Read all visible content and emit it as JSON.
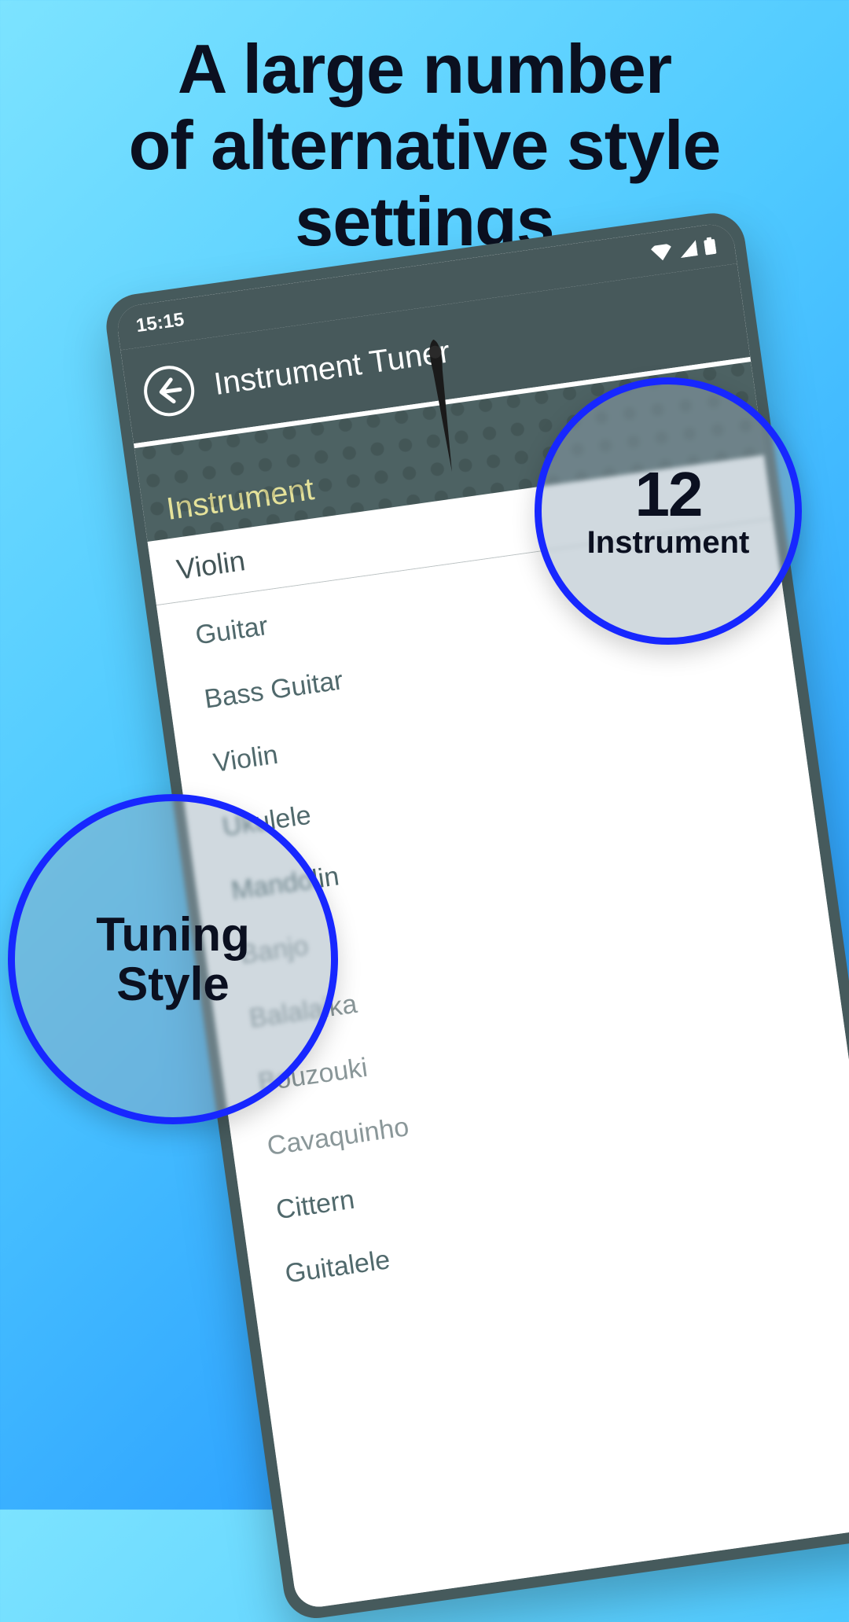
{
  "headline": {
    "line1": "A large number",
    "line2": "of alternative style",
    "line3": "settings"
  },
  "statusbar": {
    "time": "15:15"
  },
  "app": {
    "title": "Instrument Tuner"
  },
  "section": {
    "label": "Instrument"
  },
  "dropdown": {
    "selected": "Violin"
  },
  "instruments": [
    "Guitar",
    "Bass Guitar",
    "Violin",
    "Ukulele",
    "Mandolin",
    "Banjo",
    "Balalaika",
    "Bouzouki",
    "Cavaquinho",
    "Cittern",
    "Guitalele"
  ],
  "badges": {
    "top": {
      "number": "12",
      "label": "Instrument"
    },
    "bottom": {
      "line1": "Tuning",
      "line2": "Style"
    }
  }
}
